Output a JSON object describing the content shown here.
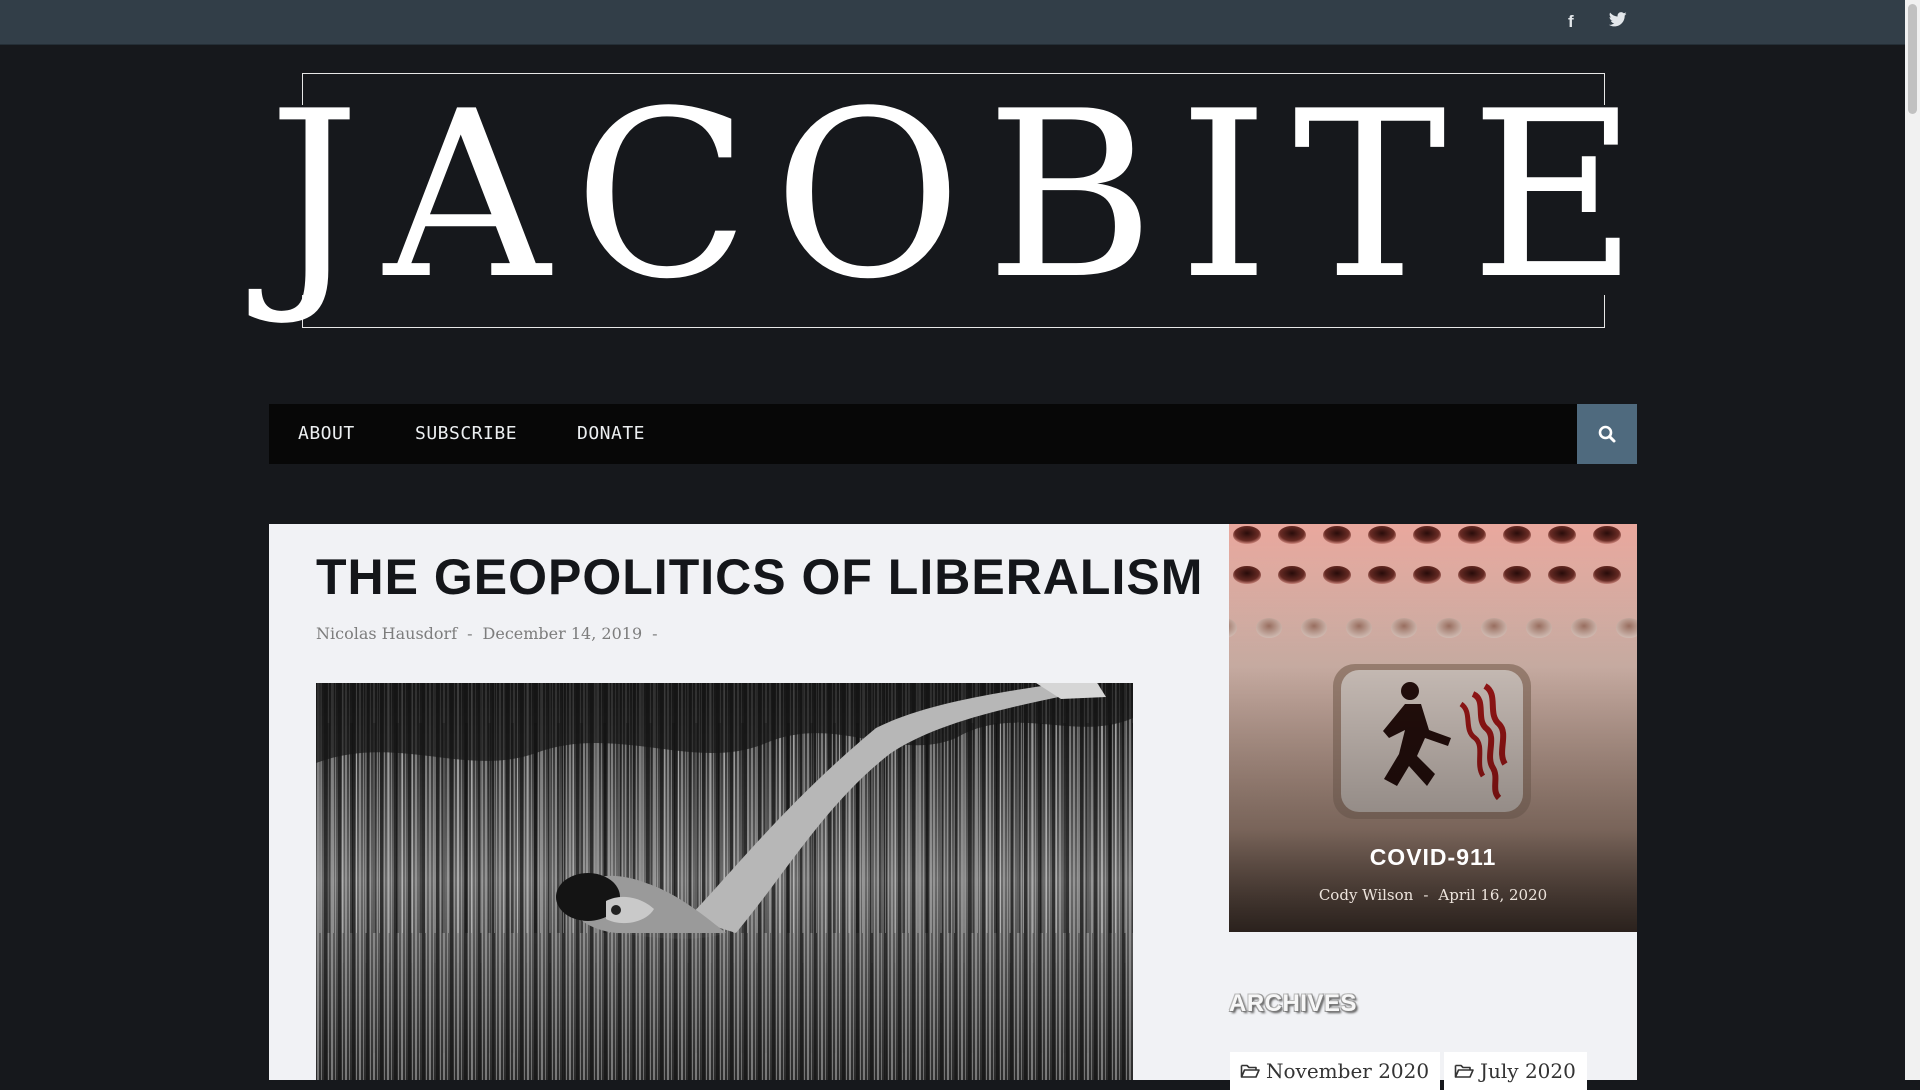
{
  "topbar": {
    "social": [
      {
        "icon": "facebook-icon",
        "glyph": "f"
      },
      {
        "icon": "twitter-icon"
      }
    ]
  },
  "logo": {
    "letters": [
      "J",
      "A",
      "C",
      "O",
      "B",
      "I",
      "T",
      "E"
    ]
  },
  "nav": {
    "items": [
      "ABOUT",
      "SUBSCRIBE",
      "DONATE"
    ],
    "search_icon": "search-icon"
  },
  "post": {
    "title": "THE GEOPOLITICS OF LIBERALISM",
    "author": "Nicolas Hausdorf",
    "sep": "-",
    "date": "December 14, 2019",
    "trail": "-"
  },
  "sidebar": {
    "feature": {
      "title": "COVID-911",
      "author": "Cody Wilson",
      "sep": "-",
      "date": "April 16, 2020"
    },
    "archives": {
      "title": "ARCHIVES",
      "items": [
        "November 2020",
        "July 2020"
      ],
      "icon": "folder-open-icon"
    }
  },
  "colors": {
    "background": "#16181c",
    "topbar": "#323e48",
    "nav": "#070707",
    "search_button": "#4f6a7e",
    "card": "#f1f2f5"
  }
}
